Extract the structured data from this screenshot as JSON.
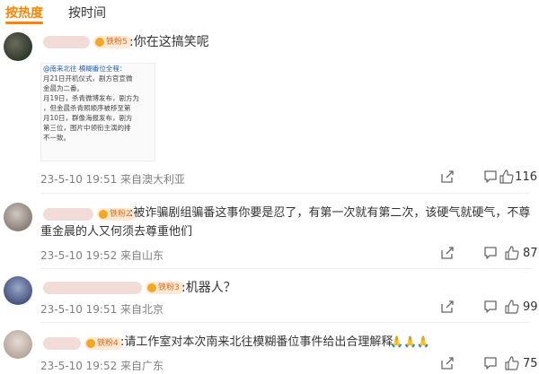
{
  "tabs": {
    "hot": "按热度",
    "time": "按时间"
  },
  "comments": [
    {
      "badge": "铁粉5",
      "text": ":你在这搞笑呢",
      "attachment_lines": [
        "@南来北往 模糊番位全程：",
        "月21日开机仪式，剧方官宣微",
        "金晨为二番。",
        "月19日，杀青微博发布，剧方为",
        "，但金晨杀青照顺序被移至第",
        "月10日，群像海报发布，剧方",
        "第三位，图片中领衔主演的排",
        "不一致。"
      ],
      "meta": "23-5-10 19:51 来自澳大利亚",
      "likes": "116"
    },
    {
      "badge": "铁粉2",
      "text_lines": [
        ":被诈骗剧组骗番这事你要是忍了，有第一次就有第二次，该硬气就硬气，不尊",
        "重金晨的人又何须去尊重他们"
      ],
      "meta": "23-5-10 19:52 来自山东",
      "likes": "87"
    },
    {
      "badge": "铁粉3",
      "text": ":机器人？",
      "meta": "23-5-10 19:51 来自北京",
      "likes": "99"
    },
    {
      "badge": "铁粉4",
      "text": ":请工作室对本次南来北往模糊番位事件给出合理解释",
      "meta": "23-5-10 19:52 来自广东",
      "likes": "75"
    }
  ],
  "colors": {
    "accent": "#ff8200",
    "meta": "#808080",
    "badge_bg": "#fde9d6",
    "badge_text": "#e06a1c"
  }
}
